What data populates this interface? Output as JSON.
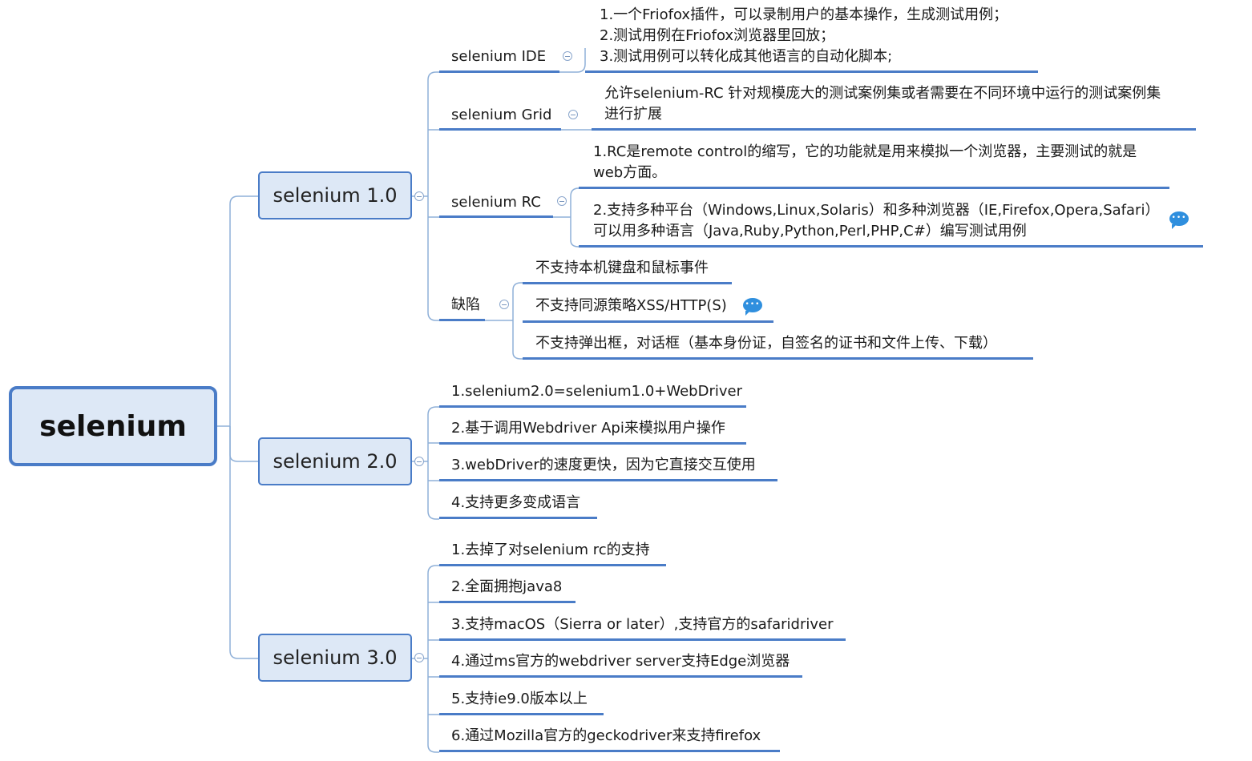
{
  "root": {
    "label": "selenium"
  },
  "v1": {
    "label": "selenium 1.0",
    "ide": {
      "label": "selenium IDE",
      "items": [
        "1.一个Friofox插件，可以录制用户的基本操作，生成测试用例；",
        "2.测试用例在Friofox浏览器里回放；",
        "3.测试用例可以转化成其他语言的自动化脚本;"
      ]
    },
    "grid": {
      "label": "selenium Grid",
      "desc": [
        "允许selenium-RC 针对规模庞大的测试案例集或者需要在不同环境中运行的测试案例集",
        "进行扩展"
      ]
    },
    "rc": {
      "label": "selenium RC",
      "item1": [
        "1.RC是remote control的缩写，它的功能就是用来模拟一个浏览器，主要测试的就是",
        "web方面。"
      ],
      "item2": [
        "2.支持多种平台（Windows,Linux,Solaris）和多种浏览器（IE,Firefox,Opera,Safari）",
        "可以用多种语言（Java,Ruby,Python,Perl,PHP,C#）编写测试用例"
      ]
    },
    "defects": {
      "label": "缺陷",
      "items": [
        "不支持本机键盘和鼠标事件",
        "不支持同源策略XSS/HTTP(S)",
        "不支持弹出框，对话框（基本身份证，自签名的证书和文件上传、下载）"
      ]
    }
  },
  "v2": {
    "label": "selenium 2.0",
    "items": [
      "1.selenium2.0=selenium1.0+WebDriver",
      "2.基于调用Webdriver Api来模拟用户操作",
      "3.webDriver的速度更快，因为它直接交互使用",
      "4.支持更多变成语言"
    ]
  },
  "v3": {
    "label": "selenium 3.0",
    "items": [
      "1.去掉了对selenium rc的支持",
      "2.全面拥抱java8",
      "3.支持macOS（Sierra or later）,支持官方的safaridriver",
      "4.通过ms官方的webdriver server支持Edge浏览器",
      "5.支持ie9.0版本以上",
      "6.通过Mozilla官方的geckodriver来支持firefox"
    ]
  },
  "colors": {
    "accent": "#4a7cc7",
    "node_fill": "#dde8f6",
    "note": "#2f8fde"
  }
}
